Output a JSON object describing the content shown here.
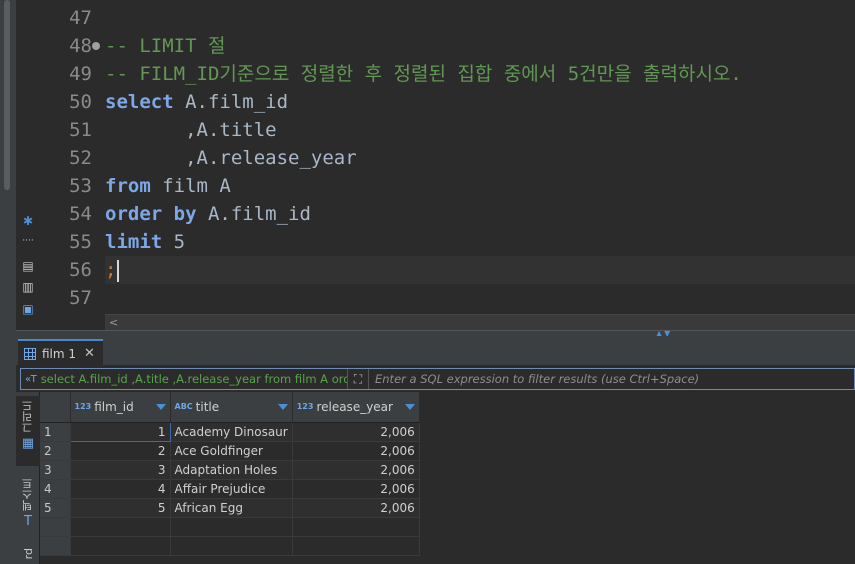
{
  "editor": {
    "lines": [
      {
        "n": "47",
        "text": ""
      },
      {
        "n": "48",
        "text": "-- LIMIT 절"
      },
      {
        "n": "49",
        "text": "-- FILM_ID기준으로 정렬한 후 정렬된 집합 중에서 5건만을 출력하시오."
      },
      {
        "n": "50",
        "kw": "select",
        "rest": " A.film_id"
      },
      {
        "n": "51",
        "text": "       ,A.title"
      },
      {
        "n": "52",
        "text": "       ,A.release_year"
      },
      {
        "n": "53",
        "kw": "from",
        "rest": " film A"
      },
      {
        "n": "54",
        "kw": "order by",
        "rest": " A.film_id"
      },
      {
        "n": "55",
        "kw": "limit",
        "rest": " 5"
      },
      {
        "n": "56",
        "punct": ";"
      },
      {
        "n": "57",
        "text": ""
      }
    ]
  },
  "result": {
    "tab_label": "film 1",
    "filter_query": "select A.film_id ,A.title ,A.release_year from film A order",
    "filter_placeholder": "Enter a SQL expression to filter results (use Ctrl+Space)",
    "side_tabs": {
      "grid": "그리드",
      "text": "텍스트",
      "record": "rd"
    },
    "columns": [
      {
        "type": "123",
        "name": "film_id"
      },
      {
        "type": "ABC",
        "name": "title"
      },
      {
        "type": "123",
        "name": "release_year"
      }
    ],
    "rows": [
      {
        "rn": "1",
        "film_id": "1",
        "title": "Academy Dinosaur",
        "release_year": "2,006"
      },
      {
        "rn": "2",
        "film_id": "2",
        "title": "Ace Goldfinger",
        "release_year": "2,006"
      },
      {
        "rn": "3",
        "film_id": "3",
        "title": "Adaptation Holes",
        "release_year": "2,006"
      },
      {
        "rn": "4",
        "film_id": "4",
        "title": "Affair Prejudice",
        "release_year": "2,006"
      },
      {
        "rn": "5",
        "film_id": "5",
        "title": "African Egg",
        "release_year": "2,006"
      }
    ]
  },
  "colors": {
    "accent": "#4a88c7",
    "keyword": "#7ea7e6",
    "comment": "#629755",
    "punct": "#cc7832"
  }
}
